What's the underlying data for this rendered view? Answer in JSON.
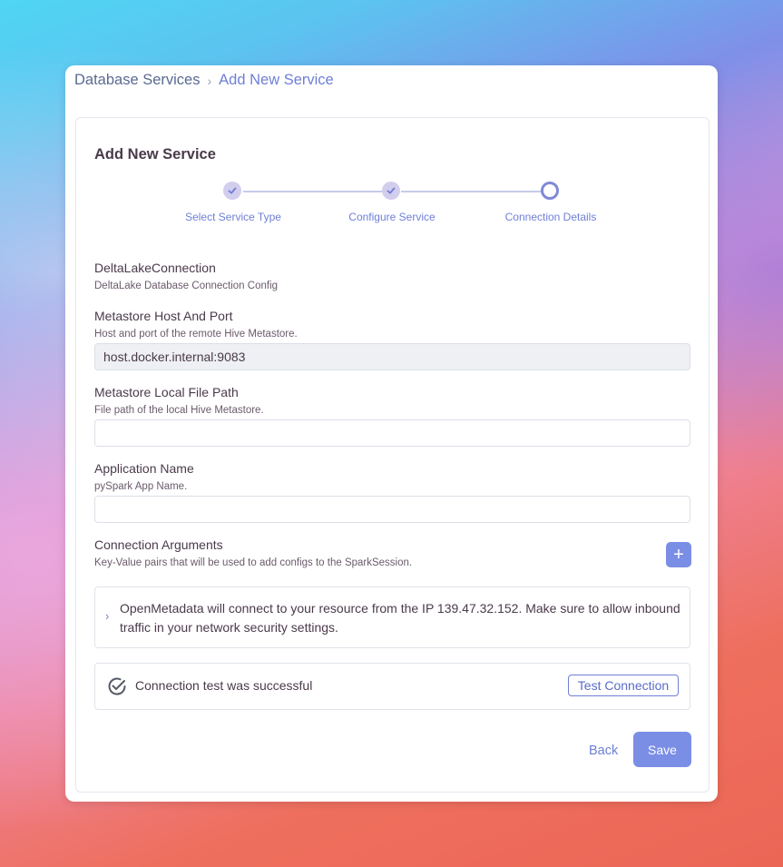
{
  "breadcrumb": {
    "parent": "Database Services",
    "separator": "›",
    "current": "Add New Service"
  },
  "page_title": "Add New Service",
  "stepper": {
    "steps": [
      {
        "label": "Select Service Type",
        "state": "done",
        "icon": "check-icon"
      },
      {
        "label": "Configure Service",
        "state": "done",
        "icon": "check-icon"
      },
      {
        "label": "Connection Details",
        "state": "active",
        "icon": "circle-icon"
      }
    ]
  },
  "connection": {
    "title": "DeltaLakeConnection",
    "description": "DeltaLake Database Connection Config"
  },
  "fields": {
    "metastore_host_port": {
      "label": "Metastore Host And Port",
      "description": "Host and port of the remote Hive Metastore.",
      "value": "host.docker.internal:9083"
    },
    "metastore_file_path": {
      "label": "Metastore Local File Path",
      "description": "File path of the local Hive Metastore.",
      "value": ""
    },
    "app_name": {
      "label": "Application Name",
      "description": "pySpark App Name.",
      "value": ""
    },
    "connection_arguments": {
      "label": "Connection Arguments",
      "description": "Key-Value pairs that will be used to add configs to the SparkSession.",
      "add_icon": "plus-icon",
      "add_symbol": "+"
    }
  },
  "ip_notice": {
    "chevron": "›",
    "message": "OpenMetadata will connect to your resource from the IP 139.47.32.152. Make sure to allow inbound traffic in your network security settings."
  },
  "connection_test": {
    "status": "Connection test was successful",
    "button_label": "Test Connection",
    "icon": "check-circle-icon"
  },
  "actions": {
    "back_label": "Back",
    "save_label": "Save"
  },
  "colors": {
    "accent": "#6f7fd6",
    "primary_button": "#7b8ee6",
    "step_done": "#d3cdee"
  }
}
